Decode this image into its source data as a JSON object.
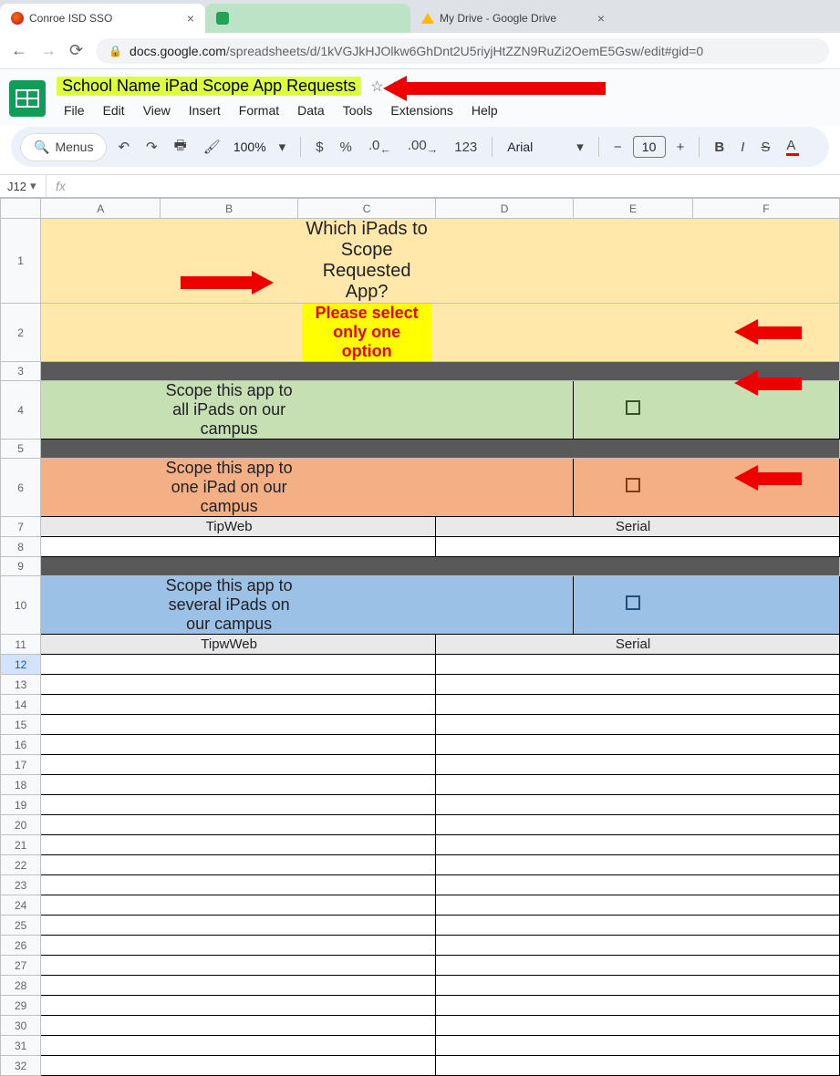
{
  "browser": {
    "tabs": [
      {
        "title": "Conroe ISD SSO"
      },
      {
        "title": ""
      },
      {
        "title": "My Drive - Google Drive"
      }
    ],
    "url_host": "docs.google.com",
    "url_path": "/spreadsheets/d/1kVGJkHJOlkw6GhDnt2U5riyjHtZZN9RuZi2OemE5Gsw/edit#gid=0"
  },
  "doc": {
    "title": "School Name iPad Scope App Requests",
    "menus": [
      "File",
      "Edit",
      "View",
      "Insert",
      "Format",
      "Data",
      "Tools",
      "Extensions",
      "Help"
    ]
  },
  "toolbar": {
    "menus_label": "Menus",
    "zoom": "100%",
    "currency": "$",
    "percent": "%",
    "dec_dec": ".0",
    "dec_inc": ".00",
    "numfmt": "123",
    "font": "Arial",
    "font_size": "10",
    "minus": "−",
    "plus": "+",
    "bold": "B",
    "italic": "I",
    "strike": "S",
    "textcolor": "A"
  },
  "fx": {
    "cell_ref": "J12",
    "fx_label": "fx"
  },
  "columns": [
    "A",
    "B",
    "C",
    "D",
    "E",
    "F"
  ],
  "row_numbers": [
    "1",
    "2",
    "3",
    "4",
    "5",
    "6",
    "7",
    "8",
    "9",
    "10",
    "11",
    "12",
    "13",
    "14",
    "15",
    "16",
    "17",
    "18",
    "19",
    "20",
    "21",
    "22",
    "23",
    "24",
    "25",
    "26",
    "27",
    "28",
    "29",
    "30",
    "31",
    "32"
  ],
  "rows": {
    "r1_title": "Which iPads to Scope Requested App?",
    "r2_note": "Please select only one option",
    "r4_label": "Scope this app to all iPads on our campus",
    "r6_label": "Scope this app to one iPad on our campus",
    "r7_a": "TipWeb",
    "r7_b": "Serial",
    "r10_label": "Scope this app to several iPads on our campus",
    "r11_a": "TipwWeb",
    "r11_b": "Serial"
  }
}
